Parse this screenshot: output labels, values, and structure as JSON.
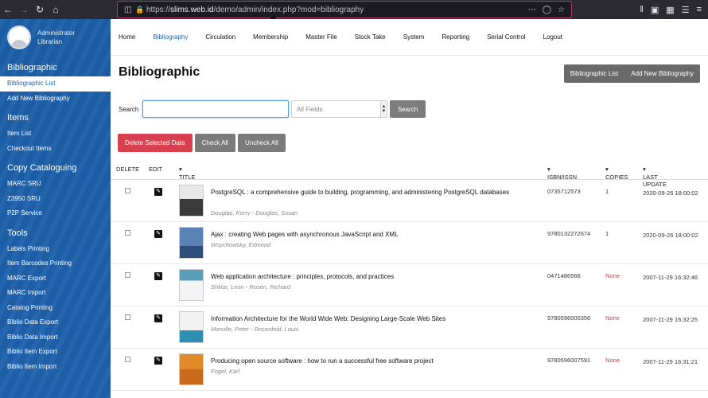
{
  "browser": {
    "url_prefix": "https://",
    "url_host": "slims.web.id",
    "url_path": "/demo/admin/index.php?mod=bibliography"
  },
  "sidebar": {
    "user_name": "Administrator",
    "user_role": "Librarian",
    "sections": [
      {
        "title": "Bibliographic",
        "items": [
          "Bibliographic List",
          "Add New Bibliography"
        ]
      },
      {
        "title": "Items",
        "items": [
          "Item List",
          "Checkout Items"
        ]
      },
      {
        "title": "Copy Cataloguing",
        "items": [
          "MARC SRU",
          "Z3950 SRU",
          "P2P Service"
        ]
      },
      {
        "title": "Tools",
        "items": [
          "Labels Printing",
          "Item Barcodes Printing",
          "MARC Export",
          "MARC Import",
          "Catalog Printing",
          "Biblio Data Export",
          "Biblio Data Import",
          "Biblio Item Export",
          "Biblio Item Import"
        ]
      }
    ]
  },
  "topnav": [
    "Home",
    "Bibliography",
    "Circulation",
    "Membership",
    "Master File",
    "Stock Take",
    "System",
    "Reporting",
    "Serial Control",
    "Logout"
  ],
  "main": {
    "title": "Bibliographic",
    "btn_list": "Bibliographic List",
    "btn_add": "Add New Bibliography",
    "search_label": "Search",
    "search_value": "",
    "field_select": "All Fields",
    "search_btn": "Search",
    "delete_btn": "Delete Selected Data",
    "check_all": "Check All",
    "uncheck_all": "Uncheck All"
  },
  "table": {
    "headers": {
      "delete": "DELETE",
      "edit": "EDIT",
      "title": "TITLE",
      "isbn": "ISBN/ISSN",
      "copies": "COPIES",
      "updated": "LAST UPDATE"
    },
    "rows": [
      {
        "title": "PostgreSQL : a comprehensive guide to building, programming, and administering PostgreSQL databases",
        "author": "Douglas, Korry - Douglas, Susan",
        "isbn": "0735712573",
        "copies": "1",
        "updated": "2020-09-26 18:00:02",
        "cover": "#3a3a3a"
      },
      {
        "title": "Ajax : creating Web pages with asynchronous JavaScript and XML",
        "author": "Woychowsky, Edmond",
        "isbn": "9780132272674",
        "copies": "1",
        "updated": "2020-09-26 18:00:02",
        "cover": "#4a6fa0"
      },
      {
        "title": "Web application architecture : principles, protocols, and practices",
        "author": "Shklar, Leon - Rosen, Richard",
        "isbn": "0471486566",
        "copies": "None",
        "updated": "2007-11-29 16:32:46",
        "cover": "#5aa0b8"
      },
      {
        "title": "Information Architecture for the World Wide Web: Designing Large-Scale Web Sites",
        "author": "Morville, Peter - Rosenfeld, Louis",
        "isbn": "9780596000356",
        "copies": "None",
        "updated": "2007-11-29 16:32:25",
        "cover": "#2e8fb0"
      },
      {
        "title": "Producing open source software : how to run a successful free software project",
        "author": "Fogel, Karl",
        "isbn": "9780596007591",
        "copies": "None",
        "updated": "2007-11-29 16:31:21",
        "cover": "#e08a2a"
      }
    ]
  }
}
